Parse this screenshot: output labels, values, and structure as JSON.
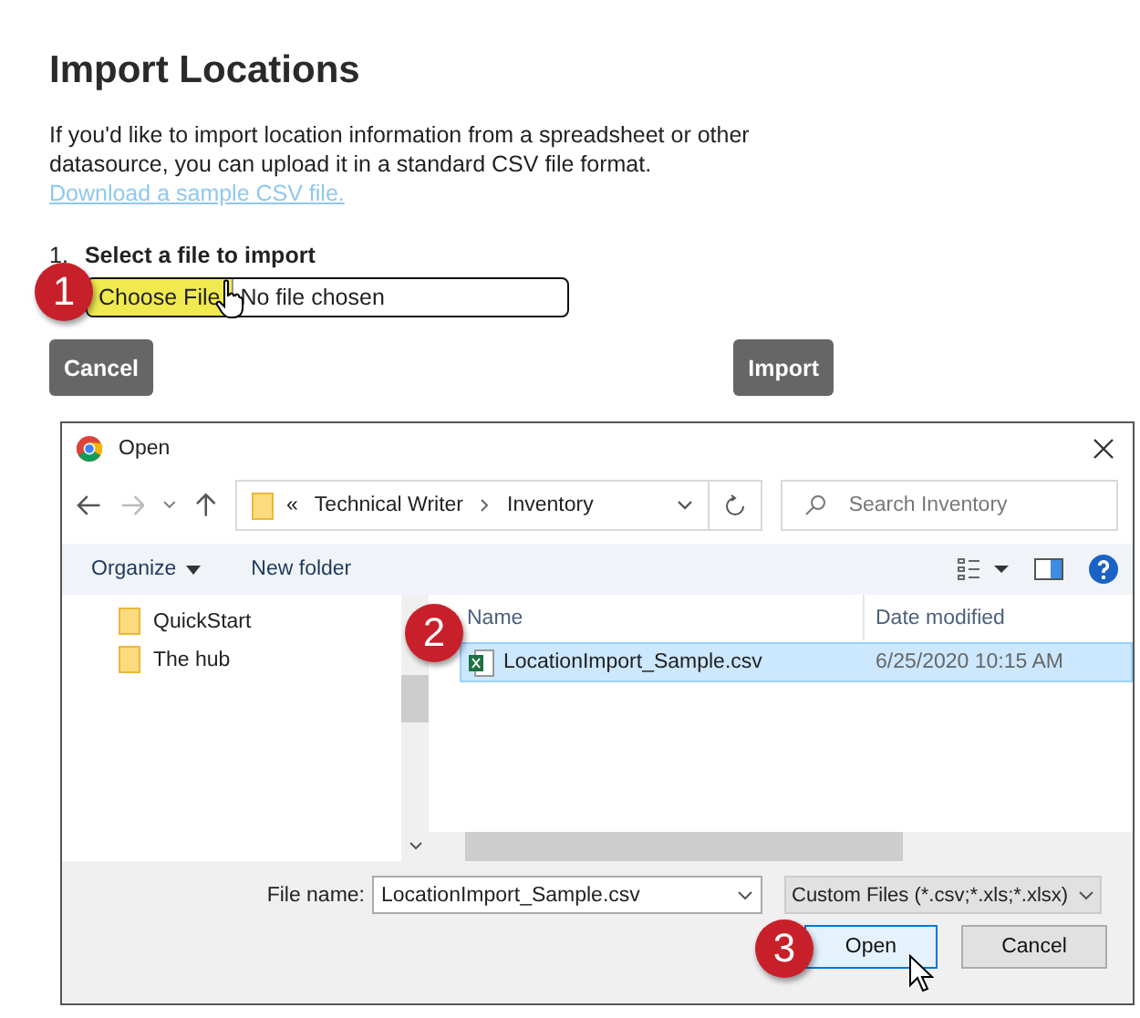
{
  "page": {
    "title": "Import Locations",
    "description": "If you'd like to import location information from a spreadsheet or other datasource, you can upload it in a standard CSV file format.",
    "link": "Download a sample CSV file.",
    "step_number": "1.",
    "step_label": "Select a file to import",
    "file_button": "Choose File",
    "file_value": "No file chosen",
    "buttons": [
      "Cancel",
      "Import"
    ]
  },
  "dialog": {
    "title": "Open",
    "path_prefix": "«",
    "path": [
      "Technical Writer",
      "Inventory"
    ],
    "search_placeholder": "Search Inventory",
    "toolbar": [
      "Organize",
      "New folder"
    ],
    "nav_items": [
      {
        "label": "QuickStart",
        "selected": false
      },
      {
        "label": "The hub",
        "selected": false
      }
    ],
    "columns": [
      "Name",
      "Date modified"
    ],
    "files": [
      {
        "name": "LocationImport_Sample.csv",
        "date": "6/25/2020 10:15 AM",
        "selected": true
      }
    ],
    "file_name_label": "File name:",
    "file_name": "LocationImport_Sample.csv",
    "filter": "Custom Files (*.csv;*.xls;*.xlsx)",
    "buttons": [
      {
        "label": "Open",
        "focused": true
      },
      {
        "label": "Cancel",
        "focused": false
      }
    ]
  },
  "callouts": [
    "1",
    "2",
    "3"
  ]
}
